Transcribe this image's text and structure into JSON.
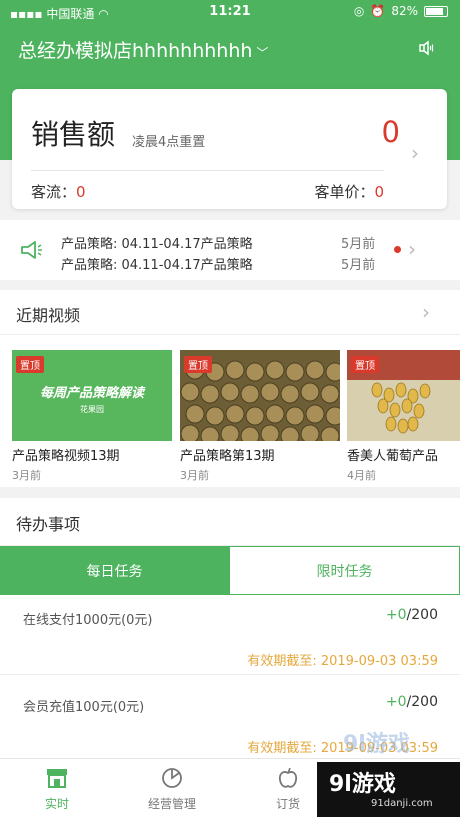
{
  "status_bar": {
    "carrier": "中国联通",
    "time": "11:21",
    "battery": "82%"
  },
  "header": {
    "store_title": "总经办模拟店hhhhhhhhhh",
    "dropdown_icon": "chevron-down-icon",
    "speaker_icon": "speaker-icon"
  },
  "sales": {
    "label": "销售额",
    "reset_note": "凌晨4点重置",
    "value": "0",
    "traffic_label": "客流：",
    "traffic_value": "0",
    "avg_price_label": "客单价：",
    "avg_price_value": "0"
  },
  "notices": {
    "items": [
      {
        "text": "产品策略: 04.11-04.17产品策略",
        "time": "5月前"
      },
      {
        "text": "产品策略: 04.11-04.17产品策略",
        "time": "5月前"
      }
    ]
  },
  "videos": {
    "title": "近期视频",
    "items": [
      {
        "badge": "置顶",
        "title": "产品策略视频13期",
        "date": "3月前",
        "thumb_text": "每周产品策略解读",
        "thumb_sub": "花果园"
      },
      {
        "badge": "置顶",
        "title": "产品策略第13期",
        "date": "3月前"
      },
      {
        "badge": "置顶",
        "title": "香美人葡萄产品",
        "date": "4月前"
      }
    ]
  },
  "todo": {
    "title": "待办事项",
    "tabs": [
      {
        "label": "每日任务"
      },
      {
        "label": "限时任务"
      }
    ],
    "tasks": [
      {
        "name": "在线支付1000元(0元)",
        "done": "+0",
        "total": "/200",
        "expire": "有效期截至: 2019-09-03 03:59"
      },
      {
        "name": "会员充值100元(0元)",
        "done": "+0",
        "total": "/200",
        "expire": "有效期截至: 2019-09-03 03:59"
      }
    ]
  },
  "tabbar": {
    "items": [
      {
        "label": "实时",
        "icon": "store-icon"
      },
      {
        "label": "经营管理",
        "icon": "pie-chart-icon"
      },
      {
        "label": "订货",
        "icon": "fruit-icon"
      }
    ]
  },
  "watermark": {
    "big": "9l游戏",
    "small": "91danji.com"
  },
  "colors": {
    "brand_green": "#4db35e",
    "alert_red": "#d93a2b",
    "expire_orange": "#e6a83c"
  }
}
